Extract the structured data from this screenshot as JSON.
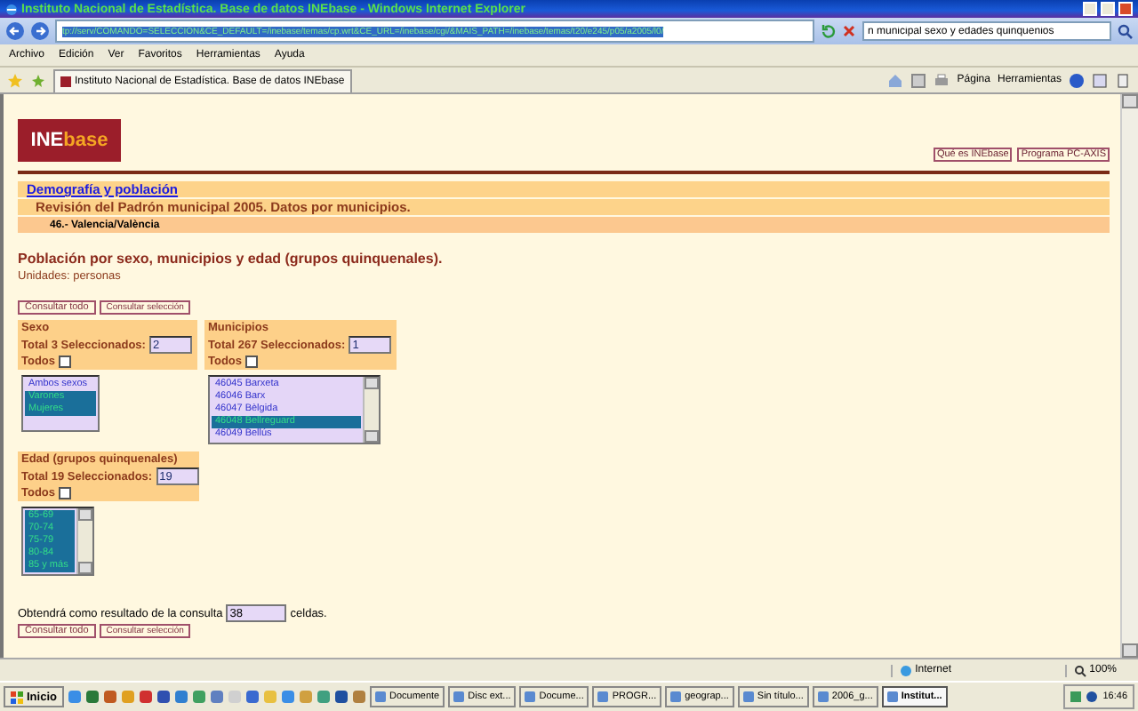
{
  "window": {
    "title": "Instituto Nacional de Estadística. Base de datos INEbase - Windows Internet Explorer"
  },
  "address_bar": {
    "url": "tp://serv/COMANDO=SELECCION&CE_DEFAULT=/inebase/temas/cp.wrt&CE_URL=/inebase/cgi/&MAIS_PATH=/inebase/temas/t20/e245/p05/a2005/l0/",
    "search_value": "n municipal sexo y edades quinquenios"
  },
  "menu": [
    "Archivo",
    "Edición",
    "Ver",
    "Favoritos",
    "Herramientas",
    "Ayuda"
  ],
  "tab": {
    "title": "Instituto Nacional de Estadística. Base de datos INEbase"
  },
  "toolbar": {
    "buttons": [
      "Página",
      "Herramientas"
    ]
  },
  "page": {
    "logo": {
      "part_1": "INE",
      "part_2": "base"
    },
    "header_links": [
      "Qué es INEbase",
      "Programa PC-AXIS"
    ],
    "breadcrumbs": [
      {
        "kind": "link",
        "text": "Demografía y población"
      },
      {
        "kind": "subtitle",
        "text": "Revisión del Padrón municipal 2005. Datos por municipios."
      },
      {
        "kind": "region",
        "text": "46.- Valencia/València"
      }
    ],
    "heading": "Población por sexo, municipios y edad (grupos quinquenales).",
    "units": "Unidades: personas",
    "top_buttons": [
      "Consultar todo",
      "Consultar selección"
    ],
    "variables": [
      {
        "title": "Sexo",
        "total_label": "Total 3 Seleccionados:",
        "selected_count": "2",
        "all_label": "Todos",
        "all_checked": false,
        "scrollbar": false,
        "options": [
          {
            "label": "Ambos sexos",
            "selected": false
          },
          {
            "label": "Varones",
            "selected": true
          },
          {
            "label": "Mujeres",
            "selected": true
          }
        ]
      },
      {
        "title": "Municipios",
        "total_label": "Total 267 Seleccionados:",
        "selected_count": "1",
        "all_label": "Todos",
        "all_checked": false,
        "scrollbar": true,
        "options": [
          {
            "label": "46045 Barxeta",
            "selected": false
          },
          {
            "label": "46046 Barx",
            "selected": false
          },
          {
            "label": "46047 Bèlgida",
            "selected": false
          },
          {
            "label": "46048 Bellreguard",
            "selected": true
          },
          {
            "label": "46049 Bellús",
            "selected": false
          }
        ]
      },
      {
        "title": "Edad (grupos quinquenales)",
        "total_label": "Total 19 Seleccionados:",
        "selected_count": "19",
        "all_label": "Todos",
        "all_checked": false,
        "scrollbar": true,
        "options": [
          {
            "label": "65-69",
            "selected": true
          },
          {
            "label": "70-74",
            "selected": true
          },
          {
            "label": "75-79",
            "selected": true
          },
          {
            "label": "80-84",
            "selected": true
          },
          {
            "label": "85 y más",
            "selected": true
          }
        ]
      }
    ],
    "result": {
      "before": "Obtendrá como resultado de la consulta",
      "value": "38",
      "after": "celdas."
    },
    "bottom_buttons": [
      "Consultar todo",
      "Consultar selección"
    ]
  },
  "status_bar": {
    "zone": "Internet",
    "zoom": "100%"
  },
  "taskbar": {
    "start": "Inicio",
    "tasks": [
      {
        "label": "Documente",
        "selected": false
      },
      {
        "label": "Disc ext...",
        "selected": false
      },
      {
        "label": "Docume...",
        "selected": false
      },
      {
        "label": "PROGR...",
        "selected": false
      },
      {
        "label": "geograp...",
        "selected": false
      },
      {
        "label": "Sin título...",
        "selected": false
      },
      {
        "label": "2006_g...",
        "selected": false
      },
      {
        "label": "Institut...",
        "selected": true
      }
    ],
    "clock": "16:46"
  }
}
